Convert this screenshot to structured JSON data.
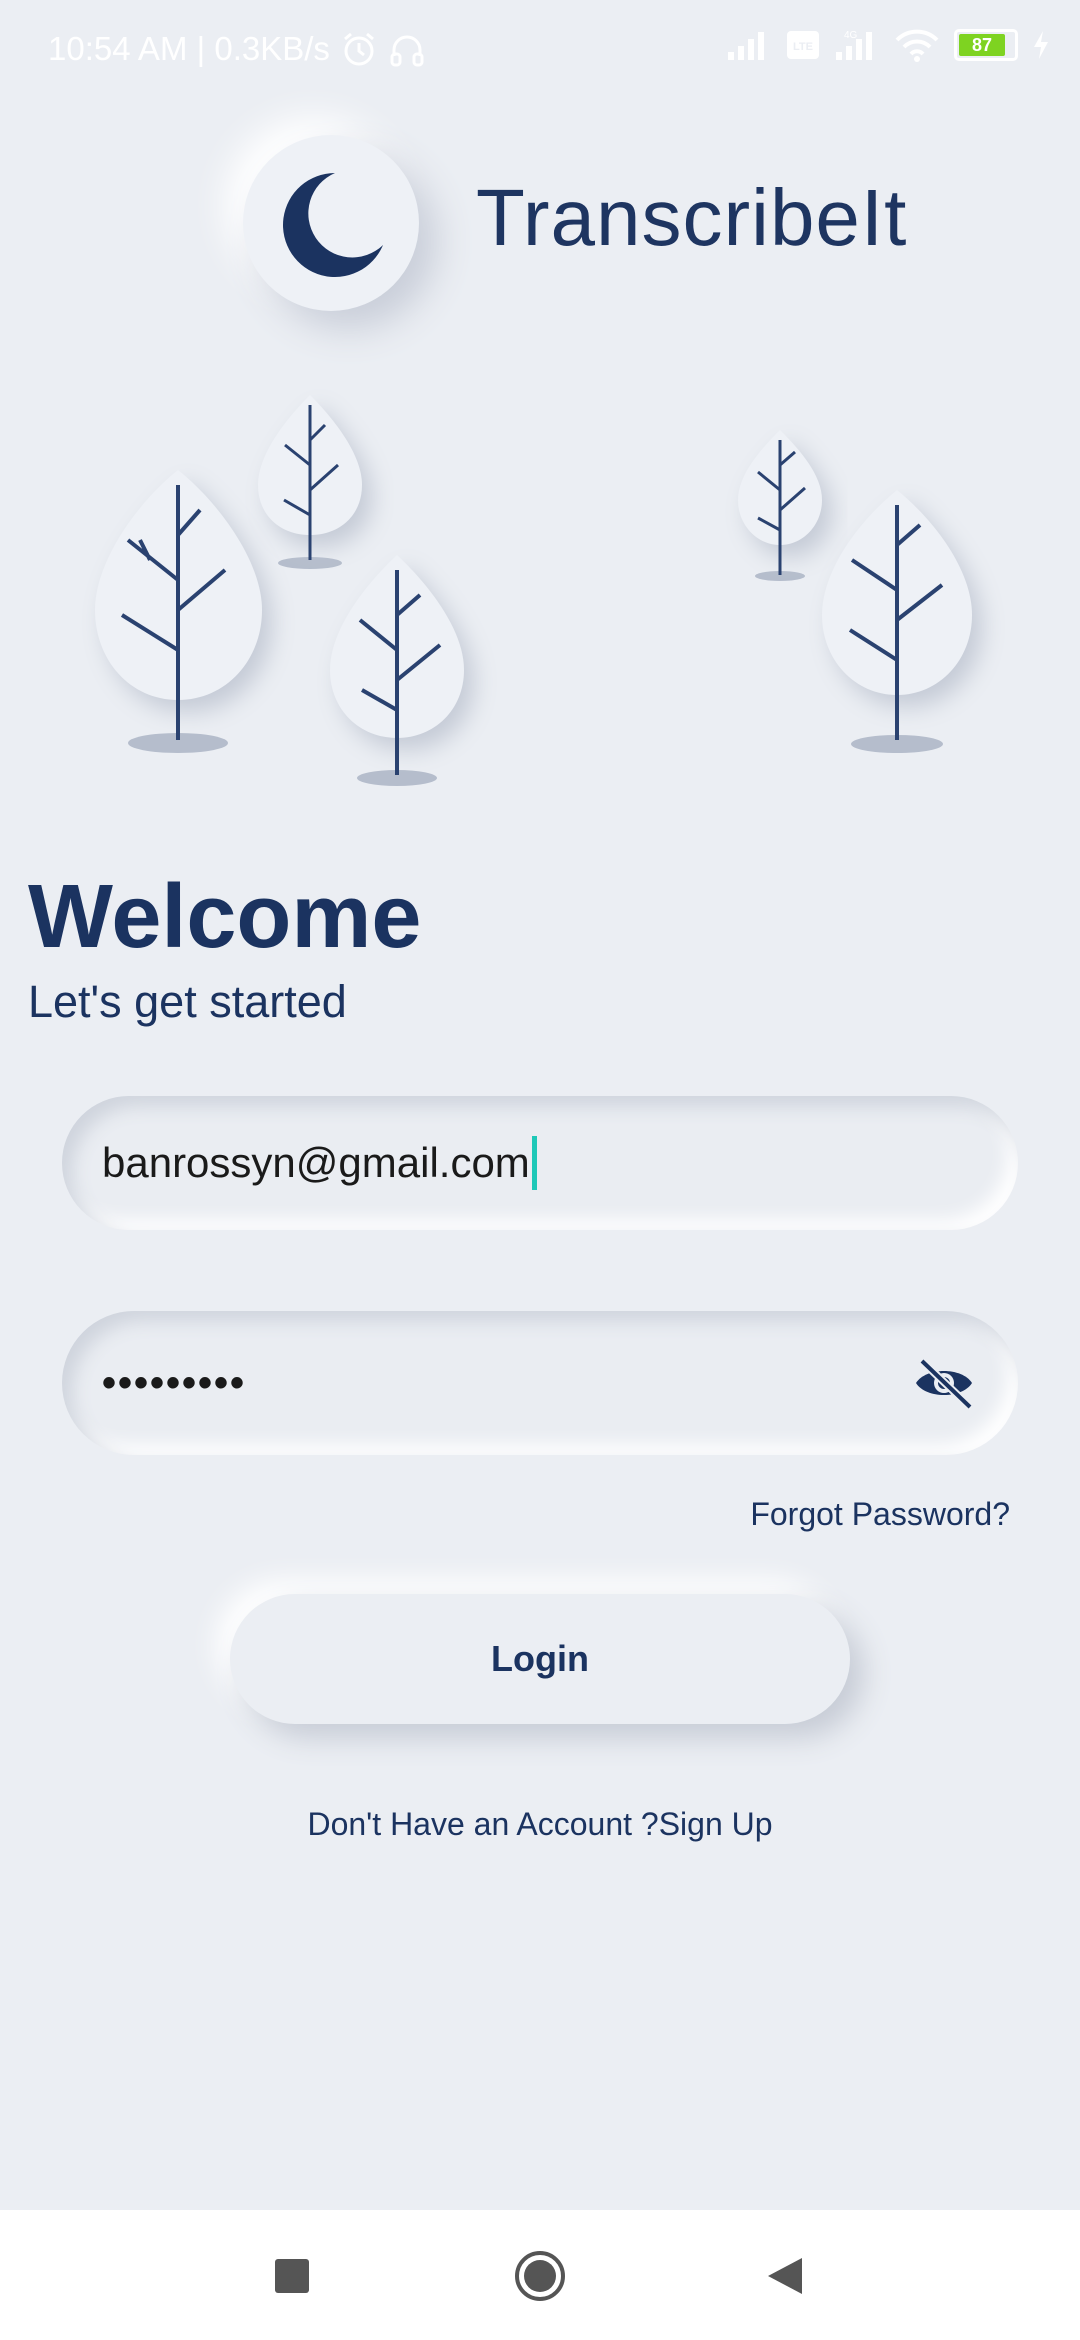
{
  "status_bar": {
    "time_speed": "10:54 AM | 0.3KB/s",
    "battery_level": "87",
    "icons": [
      "alarm-icon",
      "headphones-icon",
      "signal-icon",
      "volte-icon",
      "signal-4g-icon",
      "wifi-icon",
      "battery-icon",
      "charging-icon"
    ]
  },
  "header": {
    "app_title": "TranscribeIt",
    "logo_icon": "crescent-moon-icon"
  },
  "welcome": {
    "title": "Welcome",
    "subtitle": "Let's get started"
  },
  "form": {
    "email_value": "banrossyn@gmail.com",
    "password_value": "•••••••••",
    "visibility_icon": "eye-off-icon",
    "forgot_password": "Forgot Password?",
    "login_label": "Login"
  },
  "footer": {
    "signup_text": "Don't Have an Account ?Sign Up"
  },
  "nav_bar": {
    "icons": [
      "recent-apps-icon",
      "home-icon",
      "back-icon"
    ]
  },
  "colors": {
    "background": "#ebeef3",
    "primary": "#1b3360",
    "caret": "#1ec8b8",
    "battery": "#7ed321"
  }
}
